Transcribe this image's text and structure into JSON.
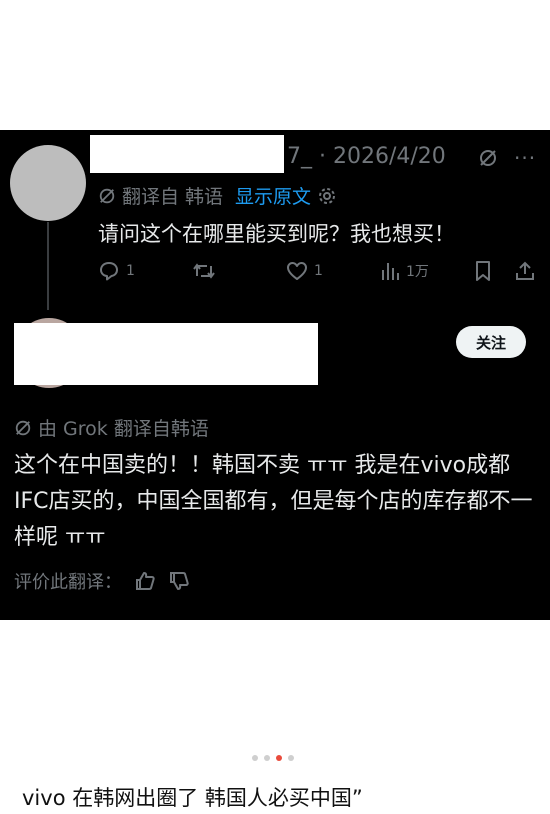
{
  "reply1": {
    "username_suffix": "7_",
    "date": "· 2026/4/20",
    "translated_from": "翻译自 韩语",
    "show_original": "显示原文",
    "text": "请问这个在哪里能买到呢？我也想买！",
    "stats": {
      "replies": "1",
      "likes": "1",
      "views": "1万"
    }
  },
  "reply2": {
    "follow": "关注",
    "grok_translated": "由 Grok 翻译自韩语",
    "text": "这个在中国卖的！！韩国不卖 ㅠㅠ 我是在vivo成都IFC店买的，中国全国都有，但是每个店的库存都不一样呢 ㅠㅠ",
    "rate_label": "评价此翻译："
  },
  "caption": "vivo 在韩网出圈了 韩国人必买中国”",
  "colors": {
    "background": "#000000",
    "link": "#1d9bf0",
    "muted": "#71767b",
    "text": "#e7e9ea",
    "active_dot": "#e94b3c"
  },
  "icons": [
    "grok-icon",
    "more-icon",
    "translate-icon",
    "settings-icon",
    "reply-icon",
    "repost-icon",
    "like-icon",
    "views-icon",
    "bookmark-icon",
    "share-icon",
    "thumbs-up-icon",
    "thumbs-down-icon"
  ],
  "carousel": {
    "total": 4,
    "active": 3
  }
}
